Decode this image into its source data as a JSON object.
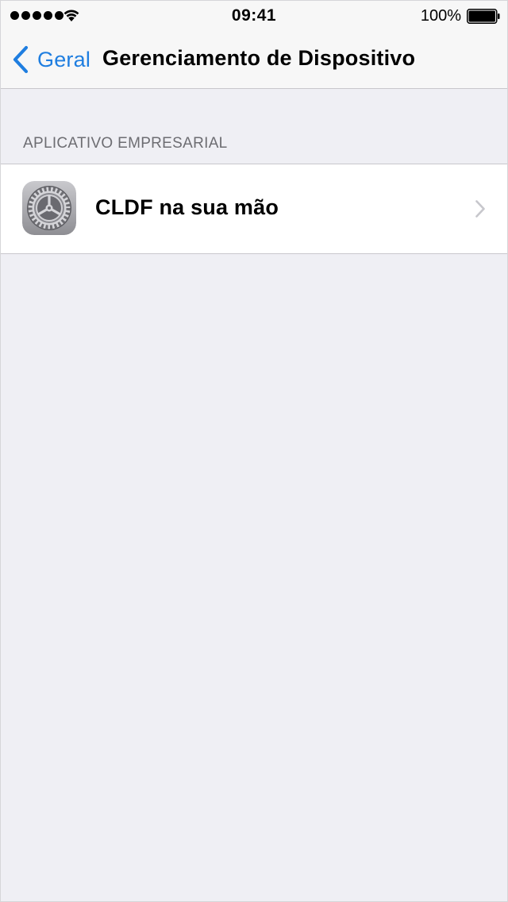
{
  "status_bar": {
    "signal_dots": 5,
    "time": "09:41",
    "battery_percent": "100%",
    "icons": [
      "signal-dots",
      "wifi-icon",
      "battery-icon"
    ]
  },
  "navbar": {
    "back_label": "Geral",
    "title": "Gerenciamento de Dispositivo",
    "back_icon": "chevron-left-icon"
  },
  "section": {
    "header": "APLICATIVO EMPRESARIAL",
    "items": [
      {
        "icon": "settings-gear-icon",
        "label": "CLDF na sua mão",
        "accessory": "chevron-right-icon"
      }
    ]
  },
  "colors": {
    "accent": "#1f7ee0",
    "background": "#efeff4",
    "bar_background": "#f7f7f7",
    "separator": "#c8c7cc",
    "section_header_text": "#6d6d72",
    "disclosure": "#c7c7cc"
  }
}
